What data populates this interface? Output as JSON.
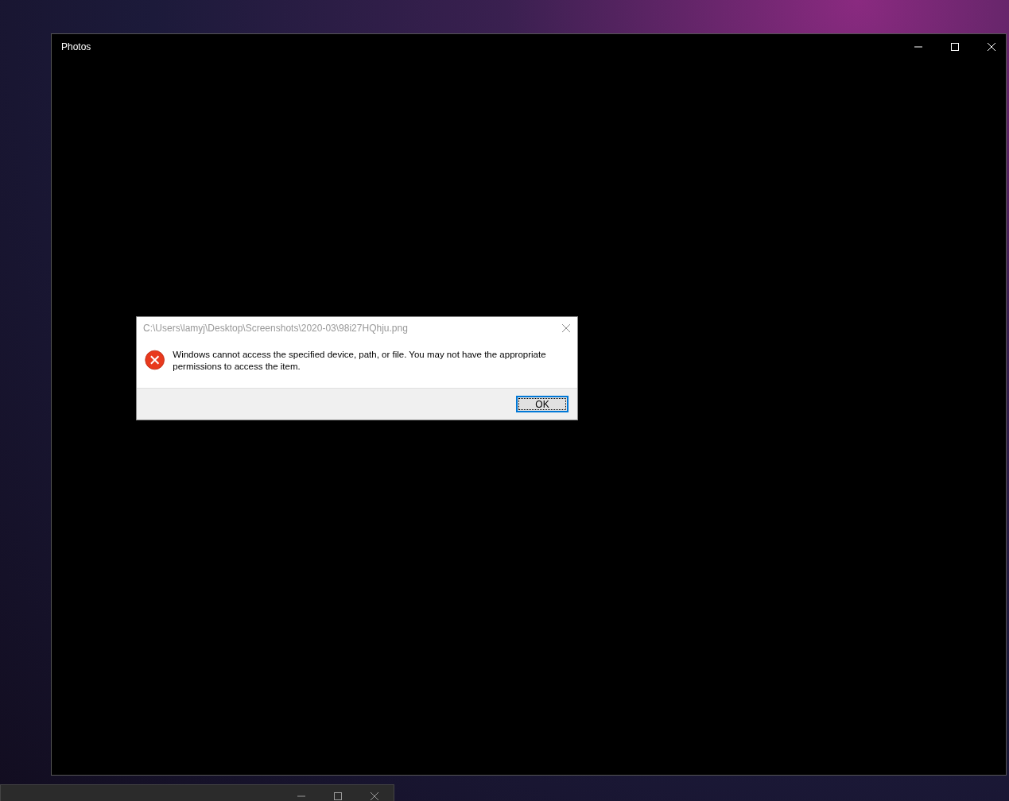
{
  "window": {
    "title": "Photos"
  },
  "dialog": {
    "title": "C:\\Users\\lamyj\\Desktop\\Screenshots\\2020-03\\98i27HQhju.png",
    "message": "Windows cannot access the specified device, path, or file. You may not have the appropriate permissions to access the item.",
    "buttons": [
      {
        "label": "OK",
        "selected": true
      }
    ]
  }
}
